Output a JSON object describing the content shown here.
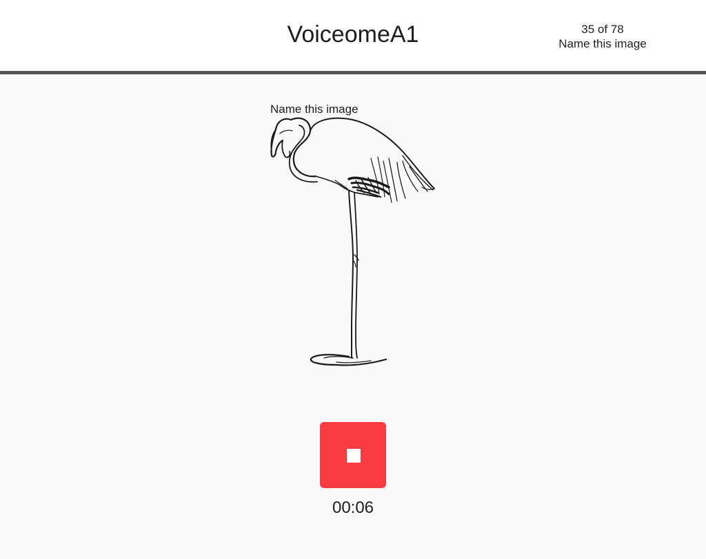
{
  "header": {
    "title": "VoiceomeA1",
    "progress_count": "35 of 78",
    "progress_task": "Name this image"
  },
  "task": {
    "prompt": "Name this image",
    "image_subject": "flamingo line drawing"
  },
  "recorder": {
    "button_icon": "stop-icon",
    "elapsed": "00:06",
    "button_color": "#f83c42"
  },
  "colors": {
    "header_bg": "#ffffff",
    "header_border": "#555555",
    "page_bg": "#f9f9f9",
    "text": "#1e1e1e"
  }
}
